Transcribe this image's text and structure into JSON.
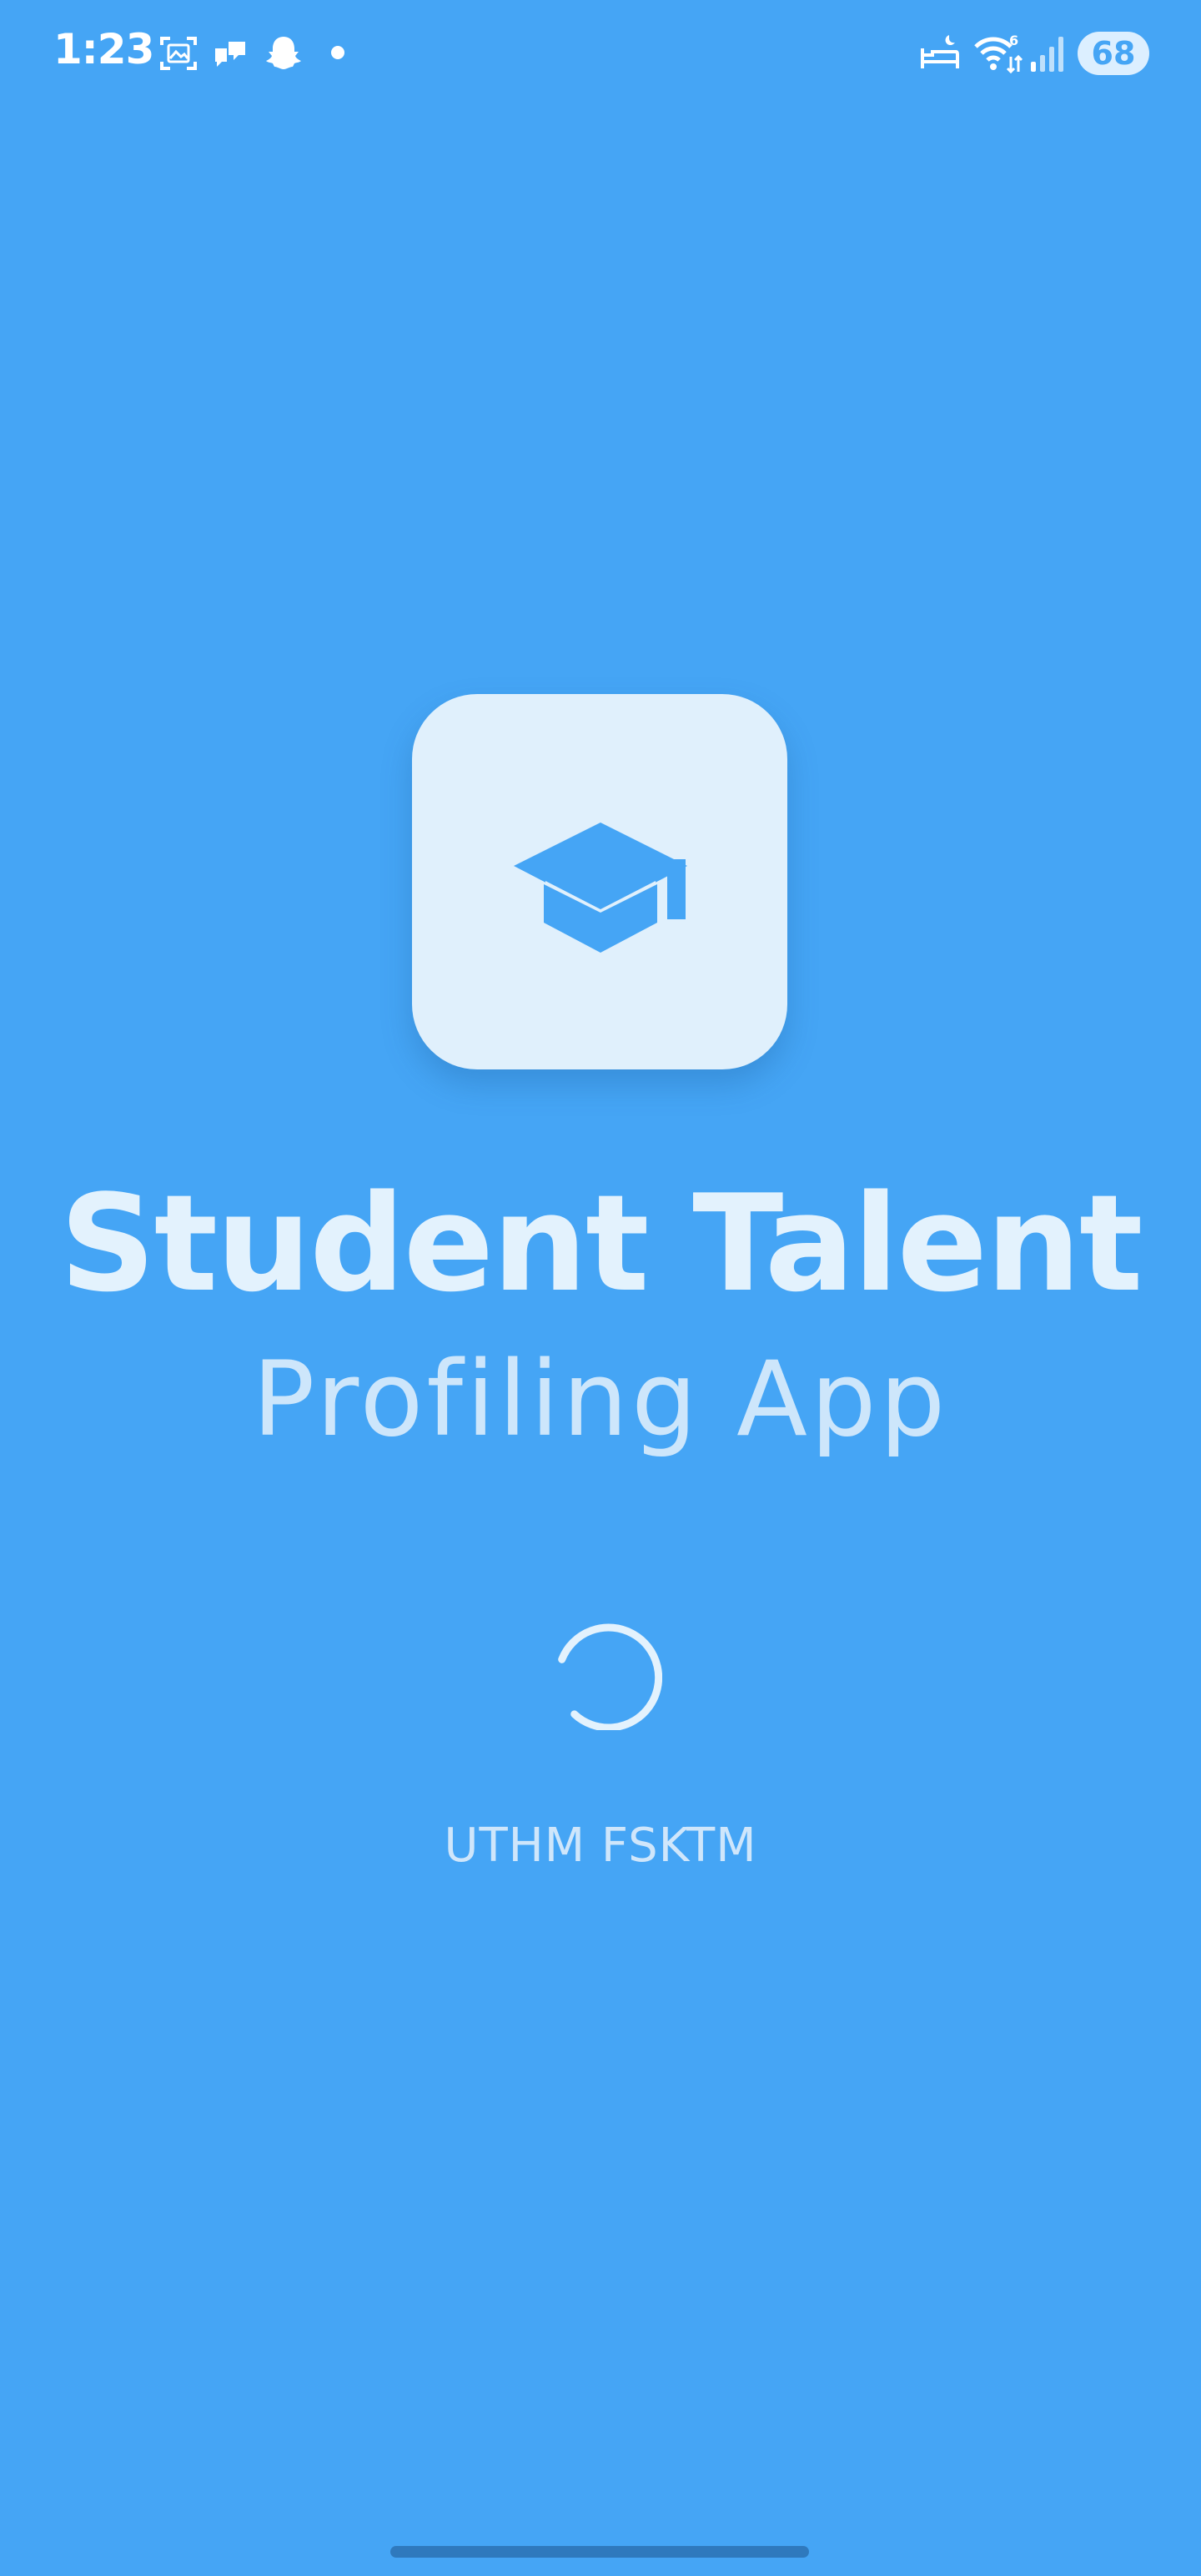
{
  "status_bar": {
    "time": "1:23",
    "battery": "68",
    "icons": [
      "screenshot-icon",
      "message-icon",
      "snapchat-icon",
      "notification-dot-icon",
      "sleep-mode-icon",
      "wifi-icon",
      "signal-icon"
    ]
  },
  "splash": {
    "title_line1": "Student Talent",
    "title_line2": "Profiling App",
    "organization": "UTHM FSKTM",
    "logo_icon": "graduation-cap-icon",
    "loading_indicator": "spinner"
  },
  "colors": {
    "background": "#45a5f5",
    "icon_tile": "#e0f0fc",
    "text_light": "#e3f2fd"
  }
}
